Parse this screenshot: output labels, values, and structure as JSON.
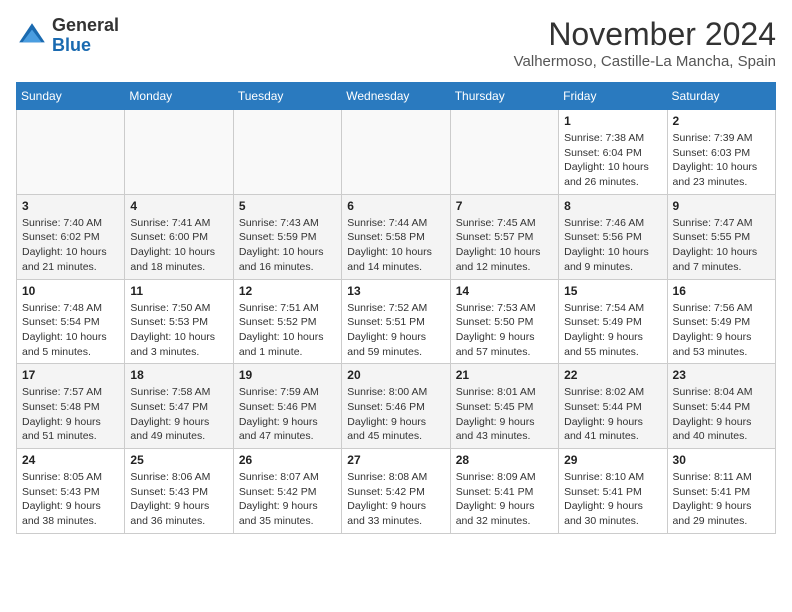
{
  "header": {
    "logo": {
      "general": "General",
      "blue": "Blue"
    },
    "month": "November 2024",
    "location": "Valhermoso, Castille-La Mancha, Spain"
  },
  "weekdays": [
    "Sunday",
    "Monday",
    "Tuesday",
    "Wednesday",
    "Thursday",
    "Friday",
    "Saturday"
  ],
  "weeks": [
    [
      {
        "day": "",
        "info": ""
      },
      {
        "day": "",
        "info": ""
      },
      {
        "day": "",
        "info": ""
      },
      {
        "day": "",
        "info": ""
      },
      {
        "day": "",
        "info": ""
      },
      {
        "day": "1",
        "info": "Sunrise: 7:38 AM\nSunset: 6:04 PM\nDaylight: 10 hours and 26 minutes."
      },
      {
        "day": "2",
        "info": "Sunrise: 7:39 AM\nSunset: 6:03 PM\nDaylight: 10 hours and 23 minutes."
      }
    ],
    [
      {
        "day": "3",
        "info": "Sunrise: 7:40 AM\nSunset: 6:02 PM\nDaylight: 10 hours and 21 minutes."
      },
      {
        "day": "4",
        "info": "Sunrise: 7:41 AM\nSunset: 6:00 PM\nDaylight: 10 hours and 18 minutes."
      },
      {
        "day": "5",
        "info": "Sunrise: 7:43 AM\nSunset: 5:59 PM\nDaylight: 10 hours and 16 minutes."
      },
      {
        "day": "6",
        "info": "Sunrise: 7:44 AM\nSunset: 5:58 PM\nDaylight: 10 hours and 14 minutes."
      },
      {
        "day": "7",
        "info": "Sunrise: 7:45 AM\nSunset: 5:57 PM\nDaylight: 10 hours and 12 minutes."
      },
      {
        "day": "8",
        "info": "Sunrise: 7:46 AM\nSunset: 5:56 PM\nDaylight: 10 hours and 9 minutes."
      },
      {
        "day": "9",
        "info": "Sunrise: 7:47 AM\nSunset: 5:55 PM\nDaylight: 10 hours and 7 minutes."
      }
    ],
    [
      {
        "day": "10",
        "info": "Sunrise: 7:48 AM\nSunset: 5:54 PM\nDaylight: 10 hours and 5 minutes."
      },
      {
        "day": "11",
        "info": "Sunrise: 7:50 AM\nSunset: 5:53 PM\nDaylight: 10 hours and 3 minutes."
      },
      {
        "day": "12",
        "info": "Sunrise: 7:51 AM\nSunset: 5:52 PM\nDaylight: 10 hours and 1 minute."
      },
      {
        "day": "13",
        "info": "Sunrise: 7:52 AM\nSunset: 5:51 PM\nDaylight: 9 hours and 59 minutes."
      },
      {
        "day": "14",
        "info": "Sunrise: 7:53 AM\nSunset: 5:50 PM\nDaylight: 9 hours and 57 minutes."
      },
      {
        "day": "15",
        "info": "Sunrise: 7:54 AM\nSunset: 5:49 PM\nDaylight: 9 hours and 55 minutes."
      },
      {
        "day": "16",
        "info": "Sunrise: 7:56 AM\nSunset: 5:49 PM\nDaylight: 9 hours and 53 minutes."
      }
    ],
    [
      {
        "day": "17",
        "info": "Sunrise: 7:57 AM\nSunset: 5:48 PM\nDaylight: 9 hours and 51 minutes."
      },
      {
        "day": "18",
        "info": "Sunrise: 7:58 AM\nSunset: 5:47 PM\nDaylight: 9 hours and 49 minutes."
      },
      {
        "day": "19",
        "info": "Sunrise: 7:59 AM\nSunset: 5:46 PM\nDaylight: 9 hours and 47 minutes."
      },
      {
        "day": "20",
        "info": "Sunrise: 8:00 AM\nSunset: 5:46 PM\nDaylight: 9 hours and 45 minutes."
      },
      {
        "day": "21",
        "info": "Sunrise: 8:01 AM\nSunset: 5:45 PM\nDaylight: 9 hours and 43 minutes."
      },
      {
        "day": "22",
        "info": "Sunrise: 8:02 AM\nSunset: 5:44 PM\nDaylight: 9 hours and 41 minutes."
      },
      {
        "day": "23",
        "info": "Sunrise: 8:04 AM\nSunset: 5:44 PM\nDaylight: 9 hours and 40 minutes."
      }
    ],
    [
      {
        "day": "24",
        "info": "Sunrise: 8:05 AM\nSunset: 5:43 PM\nDaylight: 9 hours and 38 minutes."
      },
      {
        "day": "25",
        "info": "Sunrise: 8:06 AM\nSunset: 5:43 PM\nDaylight: 9 hours and 36 minutes."
      },
      {
        "day": "26",
        "info": "Sunrise: 8:07 AM\nSunset: 5:42 PM\nDaylight: 9 hours and 35 minutes."
      },
      {
        "day": "27",
        "info": "Sunrise: 8:08 AM\nSunset: 5:42 PM\nDaylight: 9 hours and 33 minutes."
      },
      {
        "day": "28",
        "info": "Sunrise: 8:09 AM\nSunset: 5:41 PM\nDaylight: 9 hours and 32 minutes."
      },
      {
        "day": "29",
        "info": "Sunrise: 8:10 AM\nSunset: 5:41 PM\nDaylight: 9 hours and 30 minutes."
      },
      {
        "day": "30",
        "info": "Sunrise: 8:11 AM\nSunset: 5:41 PM\nDaylight: 9 hours and 29 minutes."
      }
    ]
  ]
}
